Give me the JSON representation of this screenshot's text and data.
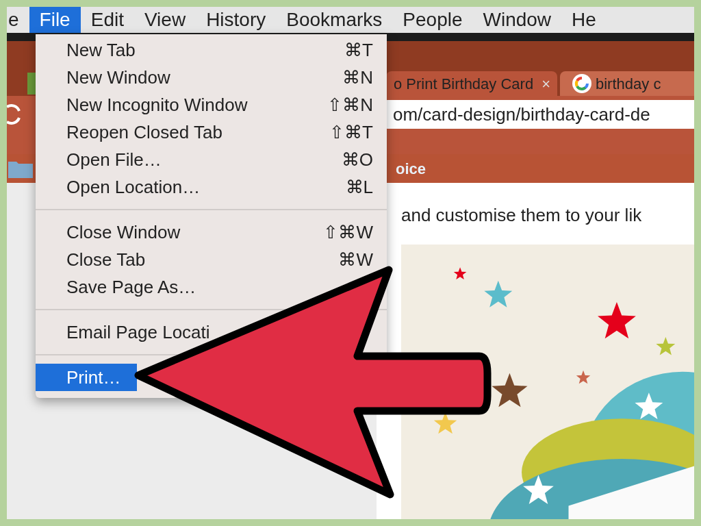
{
  "menu_bar": [
    {
      "label": "e",
      "selected": false
    },
    {
      "label": "File",
      "selected": true
    },
    {
      "label": "Edit",
      "selected": false
    },
    {
      "label": "View",
      "selected": false
    },
    {
      "label": "History",
      "selected": false
    },
    {
      "label": "Bookmarks",
      "selected": false
    },
    {
      "label": "People",
      "selected": false
    },
    {
      "label": "Window",
      "selected": false
    },
    {
      "label": "He",
      "selected": false
    }
  ],
  "file_menu": [
    {
      "kind": "item",
      "label": "New Tab",
      "shortcut": "⌘T",
      "selected": false
    },
    {
      "kind": "item",
      "label": "New Window",
      "shortcut": "⌘N",
      "selected": false
    },
    {
      "kind": "item",
      "label": "New Incognito Window",
      "shortcut": "⇧⌘N",
      "selected": false
    },
    {
      "kind": "item",
      "label": "Reopen Closed Tab",
      "shortcut": "⇧⌘T",
      "selected": false
    },
    {
      "kind": "item",
      "label": "Open File…",
      "shortcut": "⌘O",
      "selected": false
    },
    {
      "kind": "item",
      "label": "Open Location…",
      "shortcut": "⌘L",
      "selected": false
    },
    {
      "kind": "separator"
    },
    {
      "kind": "item",
      "label": "Close Window",
      "shortcut": "⇧⌘W",
      "selected": false
    },
    {
      "kind": "item",
      "label": "Close Tab",
      "shortcut": "⌘W",
      "selected": false
    },
    {
      "kind": "item",
      "label": "Save Page As…",
      "selected": false
    },
    {
      "kind": "separator"
    },
    {
      "kind": "item",
      "label": "Email Page Locati",
      "selected": false
    },
    {
      "kind": "separator"
    },
    {
      "kind": "item",
      "label": "Print…",
      "selected": true
    }
  ],
  "tabs": [
    {
      "title": "o Print Birthday Card",
      "close": "×"
    },
    {
      "title": "birthday c"
    }
  ],
  "address_bar": {
    "value": "om/card-design/birthday-card-de"
  },
  "bookmarks_bar": {
    "label": "oice"
  },
  "page": {
    "text": "and customise them to your lik"
  }
}
